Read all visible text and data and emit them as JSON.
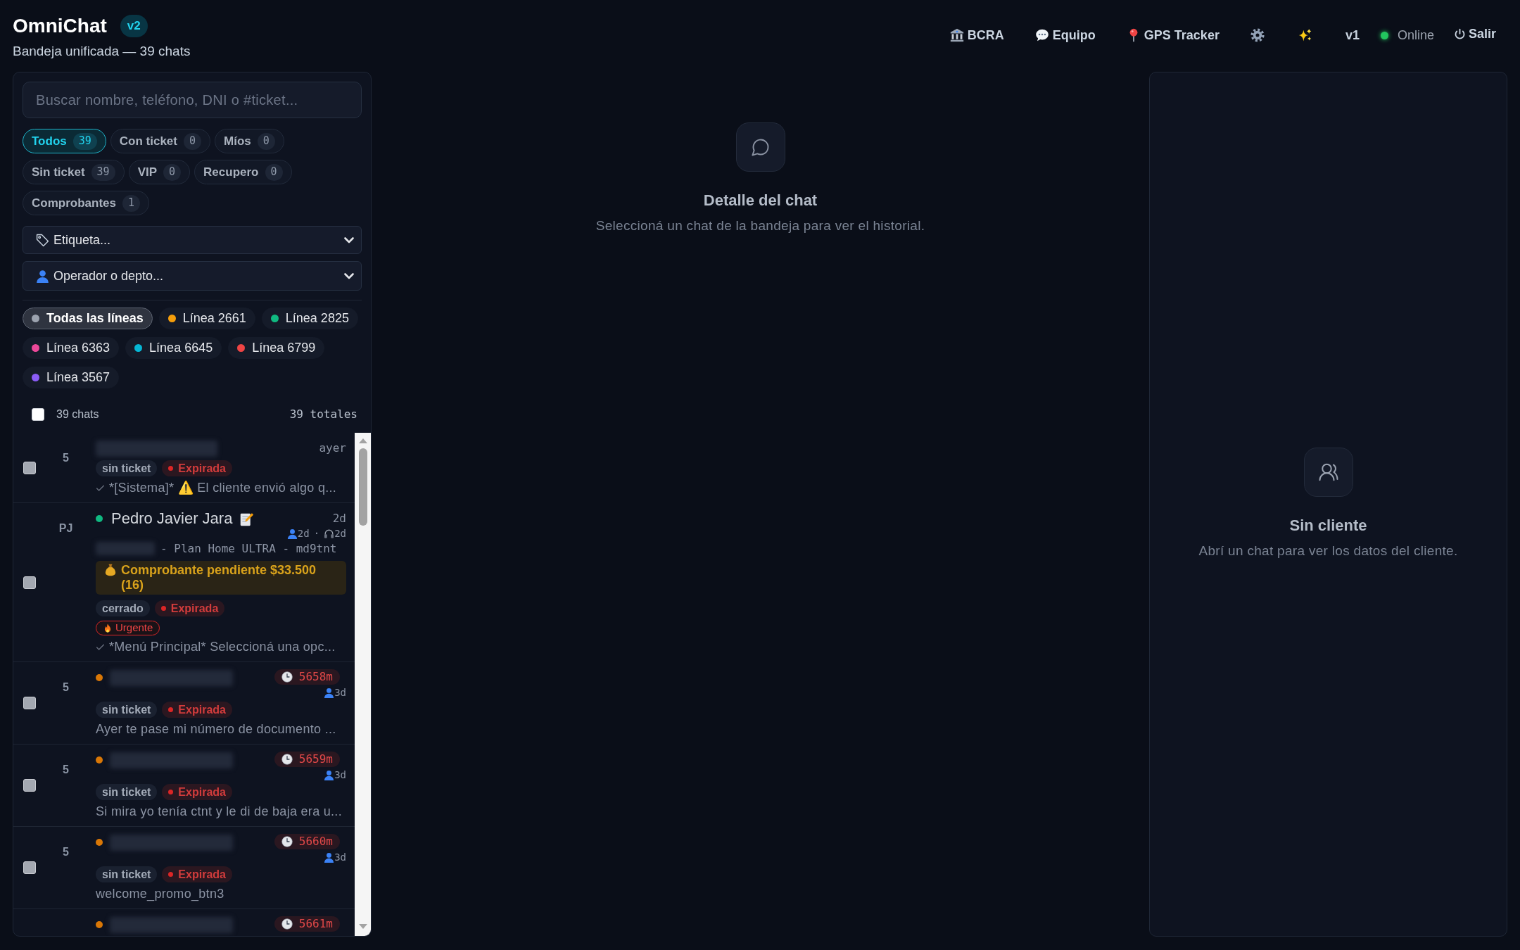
{
  "header": {
    "title": "OmniChat",
    "badge": "v2",
    "subtitle": "Bandeja unificada — 39 chats"
  },
  "nav": {
    "links": [
      {
        "label": "BCRA"
      },
      {
        "label": "Equipo"
      },
      {
        "label": "GPS Tracker"
      }
    ],
    "version": "v1",
    "status": {
      "label": "Online",
      "color": "#22c55e"
    },
    "logout": {
      "label": "Salir"
    }
  },
  "inbox": {
    "search": {
      "placeholder": "Buscar nombre, teléfono, DNI o #ticket..."
    },
    "filters": [
      {
        "label": "Todos",
        "count": "39",
        "selected": true
      },
      {
        "label": "Con ticket",
        "count": "0",
        "selected": false
      },
      {
        "label": "Míos",
        "count": "0",
        "selected": false
      },
      {
        "label": "Sin ticket",
        "count": "39",
        "selected": false
      },
      {
        "label": "VIP",
        "count": "0",
        "selected": false
      },
      {
        "label": "Recupero",
        "count": "0",
        "selected": false
      },
      {
        "label": "Comprobantes",
        "count": "1",
        "selected": false
      }
    ],
    "selects": [
      {
        "kind": "tag",
        "value": "Etiqueta..."
      },
      {
        "kind": "operator",
        "value": "Operador o depto..."
      }
    ],
    "lines": [
      {
        "label": "Todas las líneas",
        "color": "#9ca3af",
        "selected": true
      },
      {
        "label": "Línea 2661",
        "color": "#f59e0b",
        "selected": false
      },
      {
        "label": "Línea 2825",
        "color": "#10b981",
        "selected": false
      },
      {
        "label": "Línea 6363",
        "color": "#ec4899",
        "selected": false
      },
      {
        "label": "Línea 6645",
        "color": "#06b6d4",
        "selected": false
      },
      {
        "label": "Línea 6799",
        "color": "#ef4444",
        "selected": false
      },
      {
        "label": "Línea 3567",
        "color": "#8b5cf6",
        "selected": false
      }
    ],
    "list_header": {
      "checked": false,
      "count": "39 chats",
      "total": "39 totales"
    },
    "chats": [
      {
        "checked": false,
        "avatar": "5",
        "name_hidden": true,
        "time": "ayer",
        "tags": [
          {
            "kind": "ticket",
            "label": "sin ticket"
          },
          {
            "kind": "expired",
            "label": "Expirada"
          }
        ],
        "read": true,
        "preview": "*[Sistema]* ⚠️ El cliente envió algo q..."
      },
      {
        "checked": false,
        "avatar": "PJ",
        "color": "#10b981",
        "name_hidden": false,
        "name": "Pedro Javier Jara",
        "note": true,
        "time": "2d",
        "activity": [
          {
            "kind": "client",
            "text": "2d"
          },
          {
            "kind": "agent",
            "text": "2d"
          }
        ],
        "separator": "·",
        "phone_hidden": true,
        "plan": "- Plan Home ULTRA - md9tnt",
        "receipt": "Comprobante pendiente $33.500 (16)",
        "tags": [
          {
            "kind": "ticket",
            "label": "cerrado"
          },
          {
            "kind": "expired",
            "label": "Expirada"
          }
        ],
        "priority": "Urgente",
        "read": true,
        "preview": "*Menú Principal* Seleccioná una opc..."
      },
      {
        "checked": false,
        "avatar": "5",
        "color": "#d97706",
        "name_hidden": true,
        "timer": "5658m",
        "activity": [
          {
            "kind": "client",
            "text": "3d"
          }
        ],
        "tags": [
          {
            "kind": "ticket",
            "label": "sin ticket"
          },
          {
            "kind": "expired",
            "label": "Expirada"
          }
        ],
        "read": false,
        "preview": "Ayer te pase mi número de documento ..."
      },
      {
        "checked": false,
        "avatar": "5",
        "color": "#d97706",
        "name_hidden": true,
        "timer": "5659m",
        "activity": [
          {
            "kind": "client",
            "text": "3d"
          }
        ],
        "tags": [
          {
            "kind": "ticket",
            "label": "sin ticket"
          },
          {
            "kind": "expired",
            "label": "Expirada"
          }
        ],
        "read": false,
        "preview": "Si mira yo tenía ctnt y le di de baja era u..."
      },
      {
        "checked": false,
        "avatar": "5",
        "color": "#d97706",
        "name_hidden": true,
        "timer": "5660m",
        "activity": [
          {
            "kind": "client",
            "text": "3d"
          }
        ],
        "tags": [
          {
            "kind": "ticket",
            "label": "sin ticket"
          },
          {
            "kind": "expired",
            "label": "Expirada"
          }
        ],
        "read": false,
        "preview": "welcome_promo_btn3"
      },
      {
        "color": "#d97706",
        "name_hidden": true,
        "timer": "5661m"
      }
    ]
  },
  "detail": {
    "title": "Detalle del chat",
    "text": "Seleccioná un chat de la bandeja para ver el historial."
  },
  "client": {
    "title": "Sin cliente",
    "text": "Abrí un chat para ver los datos del cliente."
  }
}
